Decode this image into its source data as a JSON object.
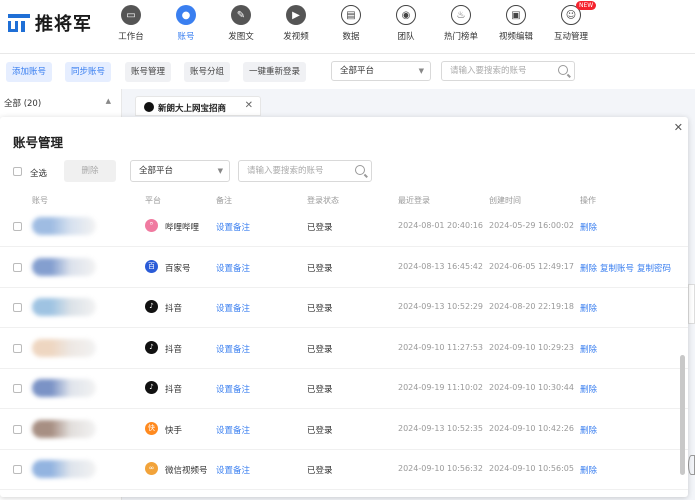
{
  "app": {
    "logo_text": "推将军"
  },
  "nav": [
    {
      "label": "工作台",
      "icon": "monitor-icon"
    },
    {
      "label": "账号",
      "icon": "user-icon",
      "active": true
    },
    {
      "label": "发图文",
      "icon": "feather-icon"
    },
    {
      "label": "发视频",
      "icon": "play-icon"
    },
    {
      "label": "数据",
      "icon": "chart-icon"
    },
    {
      "label": "团队",
      "icon": "team-icon"
    },
    {
      "label": "热门榜单",
      "icon": "fire-icon"
    },
    {
      "label": "视频编辑",
      "icon": "briefcase-icon"
    },
    {
      "label": "互动管理",
      "icon": "chat-icon",
      "badge": "NEW"
    }
  ],
  "toolbar": {
    "add_account": "添加账号",
    "sync_account": "同步账号",
    "account_manage": "账号管理",
    "account_group": "账号分组",
    "relogin_all": "一键重新登录",
    "platform_select": "全部平台",
    "search_placeholder": "请输入要搜索的账号"
  },
  "left_panel": {
    "all_label": "全部 (20)"
  },
  "open_tab": {
    "label": "新朗大上网宝招商"
  },
  "modal": {
    "title": "账号管理",
    "select_all": "全选",
    "delete": "删除",
    "platform_select": "全部平台",
    "search_placeholder": "请输入要搜索的账号",
    "columns": {
      "account": "账号",
      "platform": "平台",
      "remark": "备注",
      "login_status": "登录状态",
      "last_login": "最近登录",
      "created": "创建时间",
      "actions": "操作"
    },
    "rows": [
      {
        "platform": "哔哩哔哩",
        "pf_icon": "bilibili-icon",
        "pf_glyph": "ᴮ",
        "pf_color": "#f07aa0",
        "remark": "设置备注",
        "status": "已登录",
        "last_login": "2024-08-01 20:40:16",
        "created": "2024-05-29 16:00:02",
        "actions": [
          "删除"
        ]
      },
      {
        "platform": "百家号",
        "pf_icon": "baijiahao-icon",
        "pf_glyph": "百",
        "pf_color": "#2a5bd7",
        "remark": "设置备注",
        "status": "已登录",
        "last_login": "2024-08-13 16:45:42",
        "created": "2024-06-05 12:49:17",
        "actions": [
          "删除",
          "复制账号",
          "复制密码"
        ]
      },
      {
        "platform": "抖音",
        "pf_icon": "douyin-icon",
        "pf_glyph": "♪",
        "pf_color": "#111111",
        "remark": "设置备注",
        "status": "已登录",
        "last_login": "2024-09-13 10:52:29",
        "created": "2024-08-20 22:19:18",
        "actions": [
          "删除"
        ]
      },
      {
        "platform": "抖音",
        "pf_icon": "douyin-icon",
        "pf_glyph": "♪",
        "pf_color": "#111111",
        "remark": "设置备注",
        "status": "已登录",
        "last_login": "2024-09-10 11:27:53",
        "created": "2024-09-10 10:29:23",
        "actions": [
          "删除"
        ]
      },
      {
        "platform": "抖音",
        "pf_icon": "douyin-icon",
        "pf_glyph": "♪",
        "pf_color": "#111111",
        "remark": "设置备注",
        "status": "已登录",
        "last_login": "2024-09-19 11:10:02",
        "created": "2024-09-10 10:30:44",
        "actions": [
          "删除"
        ]
      },
      {
        "platform": "快手",
        "pf_icon": "kuaishou-icon",
        "pf_glyph": "快",
        "pf_color": "#ff8a1f",
        "remark": "设置备注",
        "status": "已登录",
        "last_login": "2024-09-13 10:52:35",
        "created": "2024-09-10 10:42:26",
        "actions": [
          "删除"
        ]
      },
      {
        "platform": "微信视频号",
        "pf_icon": "wechat-channels-icon",
        "pf_glyph": "∞",
        "pf_color": "#f2a33a",
        "remark": "设置备注",
        "status": "已登录",
        "last_login": "2024-09-10 10:56:32",
        "created": "2024-09-10 10:56:05",
        "actions": [
          "删除"
        ]
      }
    ]
  }
}
